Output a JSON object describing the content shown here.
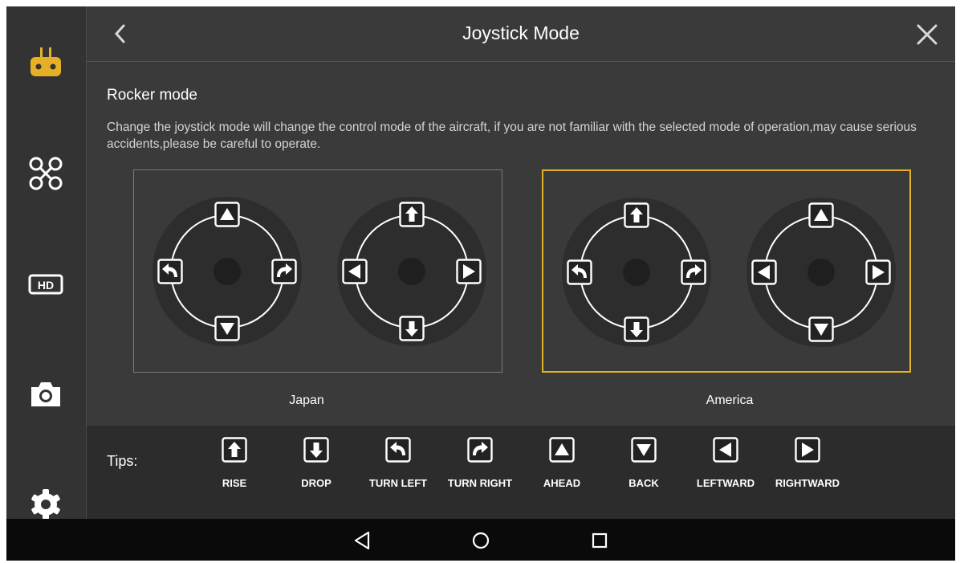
{
  "header": {
    "title": "Joystick Mode"
  },
  "section": {
    "title": "Rocker mode",
    "warning": "Change the joystick mode will change the control mode of the aircraft, if you are not familiar with the selected mode of operation,may cause serious accidents,please be careful to operate."
  },
  "modes": [
    {
      "label": "Japan",
      "selected": false
    },
    {
      "label": "America",
      "selected": true
    }
  ],
  "tips": {
    "label": "Tips:",
    "items": [
      {
        "label": "RISE",
        "icon": "rise-icon"
      },
      {
        "label": "DROP",
        "icon": "drop-icon"
      },
      {
        "label": "TURN LEFT",
        "icon": "turn-left-icon"
      },
      {
        "label": "TURN RIGHT",
        "icon": "turn-right-icon"
      },
      {
        "label": "AHEAD",
        "icon": "ahead-icon"
      },
      {
        "label": "BACK",
        "icon": "back-icon"
      },
      {
        "label": "LEFTWARD",
        "icon": "leftward-icon"
      },
      {
        "label": "RIGHTWARD",
        "icon": "rightward-icon"
      }
    ]
  },
  "sidebar": {
    "items": [
      {
        "name": "remote-controller",
        "active": true
      },
      {
        "name": "aircraft",
        "active": false
      },
      {
        "name": "hd-video",
        "active": false
      },
      {
        "name": "camera",
        "active": false
      },
      {
        "name": "settings",
        "active": false
      }
    ]
  },
  "colors": {
    "accent": "#e5b026",
    "background": "#3a3a3a",
    "sidebar": "#333333",
    "tips_bar": "#2c2c2c",
    "navbar": "#0a0a0a"
  }
}
